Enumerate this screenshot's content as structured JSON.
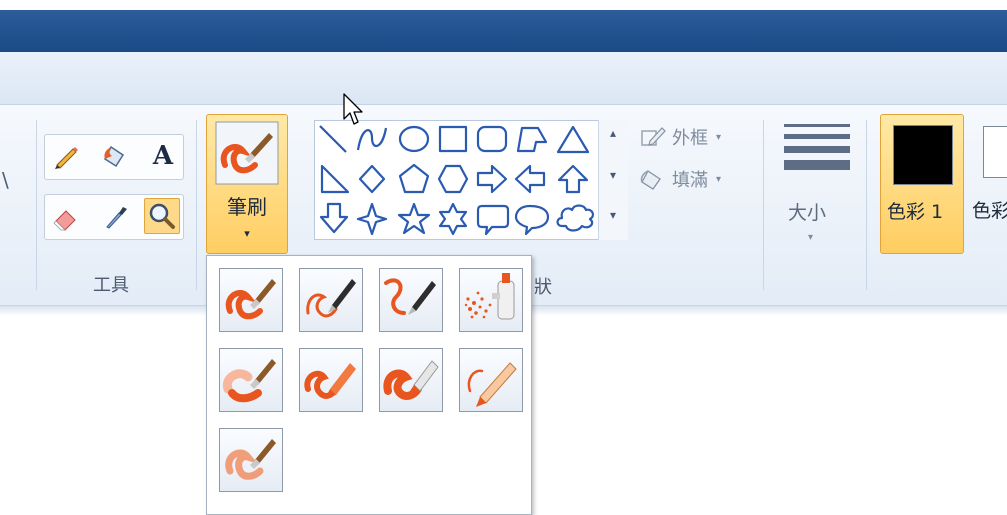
{
  "tools": {
    "group_label": "工具",
    "items": [
      "pencil-icon",
      "fill-bucket-icon",
      "text-icon",
      "eraser-icon",
      "color-picker-icon",
      "magnifier-icon"
    ],
    "text_glyph": "A",
    "selected": "magnifier"
  },
  "brushes": {
    "label": "筆刷",
    "arrow": "▾",
    "menu_items": [
      "brush",
      "calligraphy-brush-1",
      "calligraphy-brush-2",
      "airbrush",
      "oil-brush",
      "crayon",
      "marker",
      "natural-pencil",
      "watercolor-brush"
    ]
  },
  "shapes": {
    "group_label_partial": "狀",
    "items": [
      "line",
      "curve",
      "oval",
      "rectangle",
      "rounded-rectangle",
      "polygon",
      "triangle",
      "right-triangle",
      "diamond",
      "pentagon",
      "hexagon",
      "right-arrow",
      "left-arrow",
      "up-arrow",
      "down-arrow",
      "four-point-star",
      "five-point-star",
      "six-point-star",
      "rounded-callout",
      "oval-callout",
      "cloud-callout"
    ],
    "outline_label": "外框",
    "fill_label": "填滿",
    "dropdown_arrow": "▾",
    "scroll_up": "▴",
    "scroll_down": "▾",
    "scroll_more": "▾"
  },
  "size": {
    "label": "大小",
    "arrow": "▾"
  },
  "colors": {
    "color1_label": "色彩 1",
    "color2_label_partial": "色彩",
    "color1": "#000000",
    "color2": "#ffffff",
    "accent": "#ffcd61"
  },
  "left_cut_glyph": "\\"
}
